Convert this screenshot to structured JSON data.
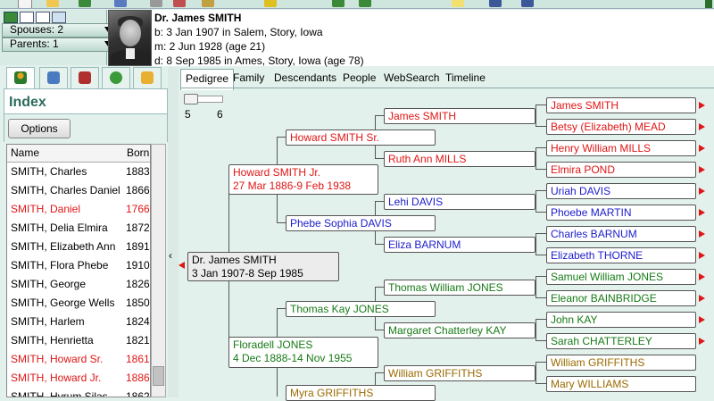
{
  "colors": {
    "male_red": "#e01515",
    "female_blue": "#1c1ccc",
    "green_line": "#167a16",
    "brown_line": "#9a6b00"
  },
  "header": {
    "spouses_label": "Spouses: 2",
    "parents_label": "Parents: 1",
    "person_name": "Dr. James SMITH",
    "birth": "b: 3 Jan 1907 in Salem, Story, Iowa",
    "marriage": "m: 2 Jun 1928 (age 21)",
    "death": "d: 8 Sep 1985 in Ames, Story, Iowa (age 78)"
  },
  "left_panel": {
    "tab_icons": [
      "individual-icon",
      "family-icon",
      "books-icon",
      "clock-icon",
      "folder-icon"
    ],
    "title": "Index",
    "options_label": "Options",
    "columns": [
      "Name",
      "Born"
    ],
    "rows": [
      {
        "name": "SMITH, Charles",
        "born": "1883",
        "color": "#000000"
      },
      {
        "name": "SMITH, Charles Daniel",
        "born": "1866",
        "color": "#000000"
      },
      {
        "name": "SMITH, Daniel",
        "born": "1766",
        "color": "#e01515"
      },
      {
        "name": "SMITH, Delia Elmira",
        "born": "1872",
        "color": "#000000"
      },
      {
        "name": "SMITH, Elizabeth Ann",
        "born": "1891",
        "color": "#000000"
      },
      {
        "name": "SMITH, Flora Phebe",
        "born": "1910",
        "color": "#000000"
      },
      {
        "name": "SMITH, George",
        "born": "1826",
        "color": "#000000"
      },
      {
        "name": "SMITH, George Wells",
        "born": "1850",
        "color": "#000000"
      },
      {
        "name": "SMITH, Harlem",
        "born": "1824",
        "color": "#000000"
      },
      {
        "name": "SMITH, Henrietta",
        "born": "1821",
        "color": "#000000"
      },
      {
        "name": "SMITH, Howard Sr.",
        "born": "1861",
        "color": "#e01515"
      },
      {
        "name": "SMITH, Howard Jr.",
        "born": "1886",
        "color": "#e01515"
      },
      {
        "name": "SMITH, Hyrum Silas",
        "born": "1862",
        "color": "#000000"
      }
    ]
  },
  "tabs": [
    "Pedigree",
    "Family",
    "Descendants",
    "People",
    "WebSearch",
    "Timeline"
  ],
  "generations": {
    "min": "5",
    "max": "6"
  },
  "pedigree": {
    "root": {
      "name": "Dr. James SMITH",
      "dates": "3 Jan 1907-8 Sep 1985"
    },
    "father": {
      "name": "Howard SMITH Jr.",
      "dates": "27 Mar 1886-9 Feb 1938"
    },
    "mother": {
      "name": "Floradell JONES",
      "dates": "4 Dec 1888-14 Nov 1955"
    },
    "gen3": [
      "Howard SMITH Sr.",
      "Phebe Sophia DAVIS",
      "Thomas Kay JONES",
      "Myra GRIFFITHS"
    ],
    "gen4": [
      "James SMITH",
      "Ruth Ann MILLS",
      "Lehi DAVIS",
      "Eliza BARNUM",
      "Thomas William JONES",
      "Margaret Chatterley KAY",
      "William GRIFFITHS"
    ],
    "gen5": [
      "James SMITH",
      "Betsy (Elizabeth) MEAD",
      "Henry William MILLS",
      "Elmira POND",
      "Uriah DAVIS",
      "Phoebe MARTIN",
      "Charles BARNUM",
      "Elizabeth THORNE",
      "Samuel William JONES",
      "Eleanor BAINBRIDGE",
      "John KAY",
      "Sarah CHATTERLEY",
      "William GRIFFITHS",
      "Mary WILLIAMS"
    ]
  }
}
